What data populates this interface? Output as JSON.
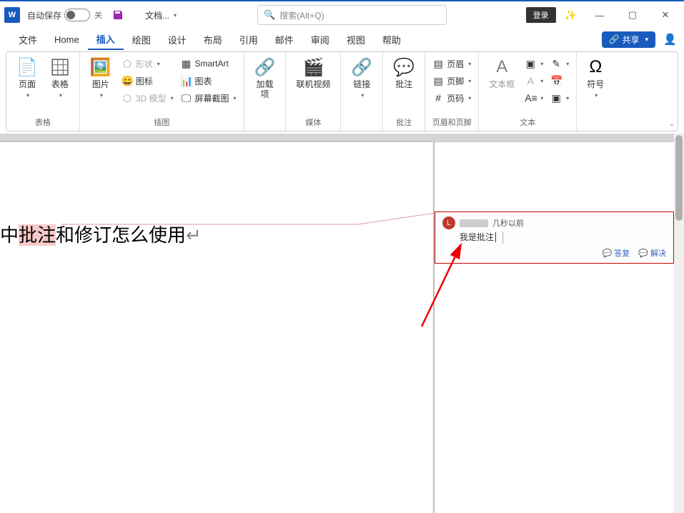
{
  "titlebar": {
    "autosave": "自动保存",
    "toggle_state": "关",
    "doc_name": "文档..."
  },
  "search": {
    "placeholder": "搜索(Alt+Q)"
  },
  "account": {
    "login": "登录"
  },
  "menu": {
    "file": "文件",
    "home": "Home",
    "insert": "插入",
    "draw": "绘图",
    "design": "设计",
    "layout": "布局",
    "references": "引用",
    "mailings": "邮件",
    "review": "审阅",
    "view": "视图",
    "help": "帮助",
    "share": "共享"
  },
  "ribbon": {
    "pages": {
      "page": "页面",
      "group": "表格"
    },
    "tables": {
      "table": "表格"
    },
    "illustrations": {
      "pictures": "图片",
      "shapes": "形状",
      "icons": "图标",
      "models3d": "3D 模型",
      "smartart": "SmartArt",
      "chart": "图表",
      "screenshot": "屏幕截图",
      "group": "插图"
    },
    "addins": {
      "addins": "加载\n项",
      "group": ""
    },
    "media": {
      "onlinevideo": "联机视频",
      "group": "媒体"
    },
    "links": {
      "link": "链接",
      "group": ""
    },
    "comments": {
      "comment": "批注",
      "group": "批注"
    },
    "headerfooter": {
      "header": "页眉",
      "footer": "页脚",
      "pagenum": "页码",
      "group": "页眉和页脚"
    },
    "text": {
      "textbox": "文本框",
      "group": "文本"
    },
    "symbols": {
      "symbol": "符号",
      "group": ""
    }
  },
  "document": {
    "pre": "中",
    "highlighted": "批注",
    "post": "和修订怎么使用"
  },
  "comment": {
    "time": "几秒以前",
    "body": "我是批注",
    "reply": "答复",
    "resolve": "解决"
  }
}
